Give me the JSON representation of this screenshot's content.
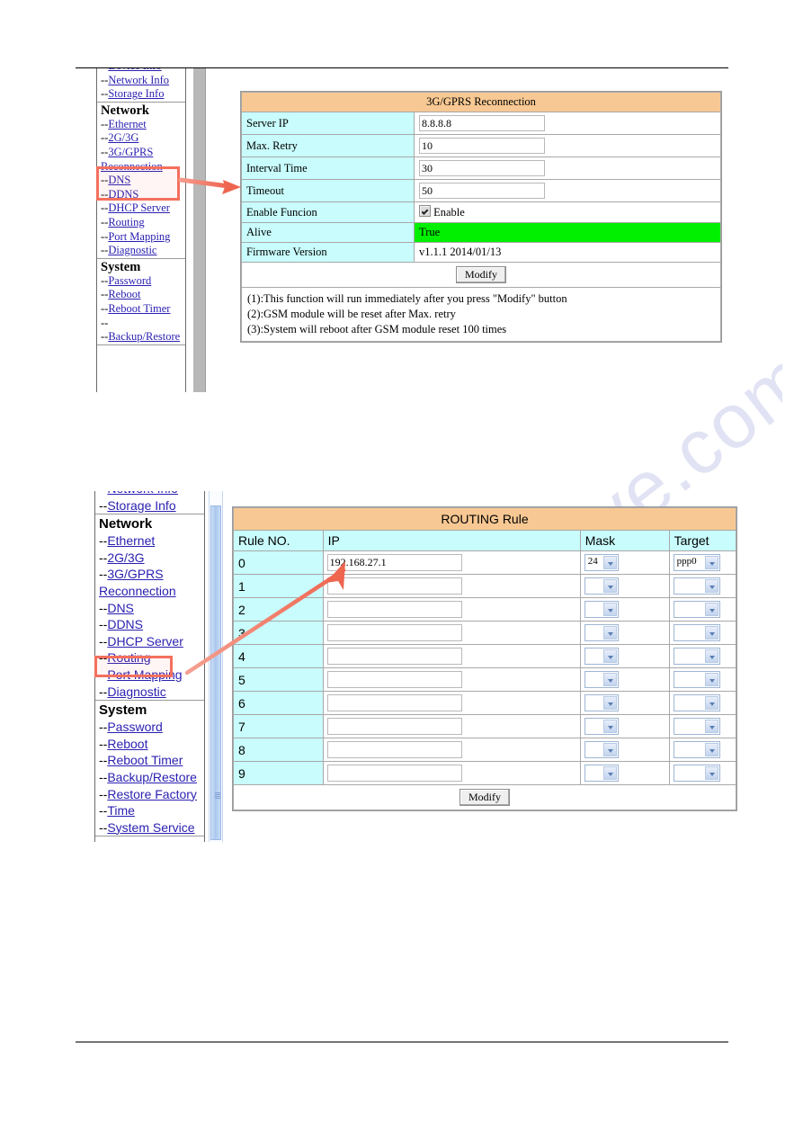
{
  "figure1": {
    "menu": {
      "clipped_top_item": "Device Info",
      "groups": [
        {
          "title": "",
          "items": [
            {
              "prefix": "--",
              "label": "Network Info"
            },
            {
              "prefix": "--",
              "label": "Storage Info"
            }
          ]
        },
        {
          "title": "Network",
          "items": [
            {
              "prefix": "--",
              "label": "Ethernet"
            },
            {
              "prefix": "--",
              "label": "2G/3G"
            },
            {
              "prefix": "--",
              "label": "3G/GPRS"
            },
            {
              "prefix": "",
              "label": "Reconnection"
            },
            {
              "prefix": "--",
              "label": "DNS"
            },
            {
              "prefix": "--",
              "label": "DDNS"
            },
            {
              "prefix": "--",
              "label": "DHCP Server"
            },
            {
              "prefix": "--",
              "label": "Routing"
            },
            {
              "prefix": "--",
              "label": "Port Mapping"
            },
            {
              "prefix": "--",
              "label": "Diagnostic"
            }
          ]
        },
        {
          "title": "System",
          "items": [
            {
              "prefix": "--",
              "label": "Password"
            },
            {
              "prefix": "--",
              "label": "Reboot"
            },
            {
              "prefix": "--",
              "label": "Reboot Timer"
            },
            {
              "prefix": "--",
              "label": ""
            },
            {
              "prefix": "--",
              "label": "Backup/Restore"
            }
          ]
        }
      ]
    },
    "table": {
      "title": "3G/GPRS Reconnection",
      "rows": [
        {
          "label": "Server IP",
          "value": "8.8.8.8",
          "type": "input"
        },
        {
          "label": "Max. Retry",
          "value": "10",
          "type": "input"
        },
        {
          "label": "Interval Time",
          "value": "30",
          "type": "input"
        },
        {
          "label": "Timeout",
          "value": "50",
          "type": "input"
        },
        {
          "label": "Enable Funcion",
          "value": "Enable",
          "type": "checkbox",
          "checked": true
        },
        {
          "label": "Alive",
          "value": "True",
          "type": "status",
          "status_color": "#00f000"
        },
        {
          "label": "Firmware Version",
          "value": "v1.1.1 2014/01/13",
          "type": "text"
        }
      ],
      "button": "Modify",
      "notes": [
        "(1):This function will run immediately after you press \"Modify\" button",
        "(2):GSM module will be reset after Max. retry",
        "(3):System will reboot after GSM module reset 100 times"
      ]
    }
  },
  "figure2": {
    "menu": {
      "clipped_top_item": "Network Info",
      "groups": [
        {
          "title": "",
          "items": [
            {
              "prefix": "--",
              "label": "Storage Info"
            }
          ]
        },
        {
          "title": "Network",
          "items": [
            {
              "prefix": "--",
              "label": "Ethernet"
            },
            {
              "prefix": "--",
              "label": "2G/3G"
            },
            {
              "prefix": "--",
              "label": "3G/GPRS"
            },
            {
              "prefix": "",
              "label": "Reconnection"
            },
            {
              "prefix": "--",
              "label": "DNS"
            },
            {
              "prefix": "--",
              "label": "DDNS"
            },
            {
              "prefix": "--",
              "label": "DHCP Server"
            },
            {
              "prefix": "--",
              "label": "Routing"
            },
            {
              "prefix": "--",
              "label": "Port Mapping"
            },
            {
              "prefix": "--",
              "label": "Diagnostic"
            }
          ]
        },
        {
          "title": "System",
          "items": [
            {
              "prefix": "--",
              "label": "Password"
            },
            {
              "prefix": "--",
              "label": "Reboot"
            },
            {
              "prefix": "--",
              "label": "Reboot Timer"
            },
            {
              "prefix": "--",
              "label": "Backup/Restore"
            },
            {
              "prefix": "--",
              "label": "Restore Factory"
            },
            {
              "prefix": "--",
              "label": "Time"
            },
            {
              "prefix": "--",
              "label": "System Service"
            }
          ]
        }
      ]
    },
    "table": {
      "title": "ROUTING Rule",
      "headers": [
        "Rule NO.",
        "IP",
        "Mask",
        "Target"
      ],
      "rows": [
        {
          "no": "0",
          "ip": "192.168.27.1",
          "mask": "24",
          "target": "ppp0"
        },
        {
          "no": "1",
          "ip": "",
          "mask": "",
          "target": ""
        },
        {
          "no": "2",
          "ip": "",
          "mask": "",
          "target": ""
        },
        {
          "no": "3",
          "ip": "",
          "mask": "",
          "target": ""
        },
        {
          "no": "4",
          "ip": "",
          "mask": "",
          "target": ""
        },
        {
          "no": "5",
          "ip": "",
          "mask": "",
          "target": ""
        },
        {
          "no": "6",
          "ip": "",
          "mask": "",
          "target": ""
        },
        {
          "no": "7",
          "ip": "",
          "mask": "",
          "target": ""
        },
        {
          "no": "8",
          "ip": "",
          "mask": "",
          "target": ""
        },
        {
          "no": "9",
          "ip": "",
          "mask": "",
          "target": ""
        }
      ],
      "button": "Modify"
    }
  },
  "annotations": {
    "highlight1": "3G/GPRS Reconnection",
    "highlight2": "Routing",
    "arrow_color": "#ef6a55"
  },
  "watermark": {
    "text": "manualshive.com"
  },
  "colors": {
    "header_orange": "#f7c893",
    "label_cyan": "#c9fcfc",
    "status_green": "#00f000",
    "link_purple": "#2a1fb0",
    "annotation_red": "#f4705e"
  }
}
